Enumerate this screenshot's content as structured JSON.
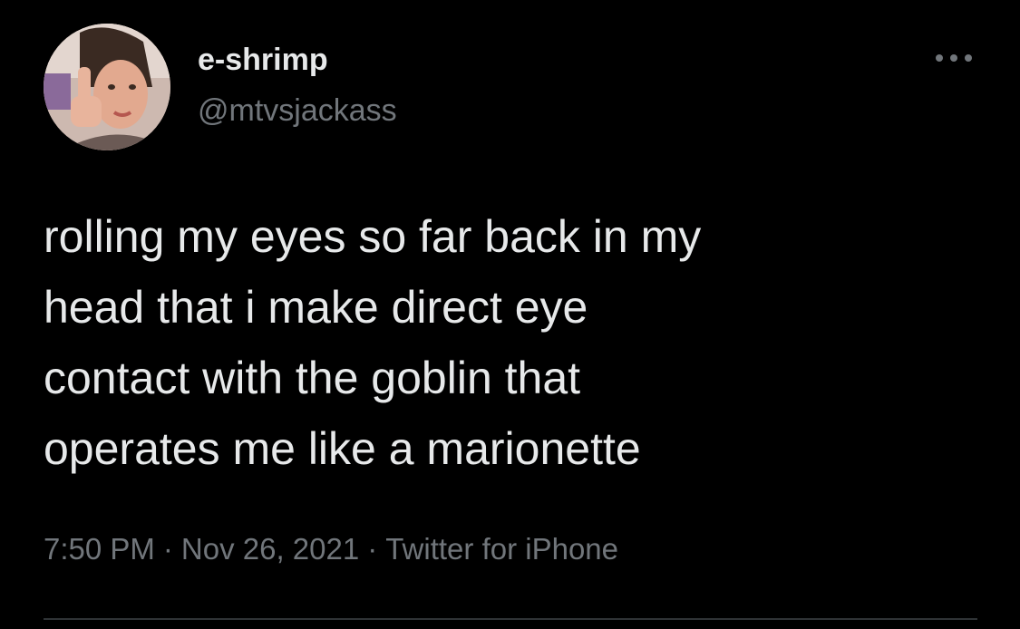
{
  "author": {
    "display_name": "e-shrimp",
    "handle": "@mtvsjackass"
  },
  "tweet": {
    "text": "rolling my eyes so far back in my\nhead that i make direct eye\ncontact with the goblin that\noperates me like a marionette"
  },
  "meta": {
    "time": "7:50 PM",
    "separator": "·",
    "date": "Nov 26, 2021",
    "source": "Twitter for iPhone"
  },
  "icons": {
    "more": "more-horizontal-icon"
  },
  "colors": {
    "background": "#000000",
    "primary_text": "#e7e9ea",
    "secondary_text": "#71767b",
    "divider": "#2f3336"
  }
}
